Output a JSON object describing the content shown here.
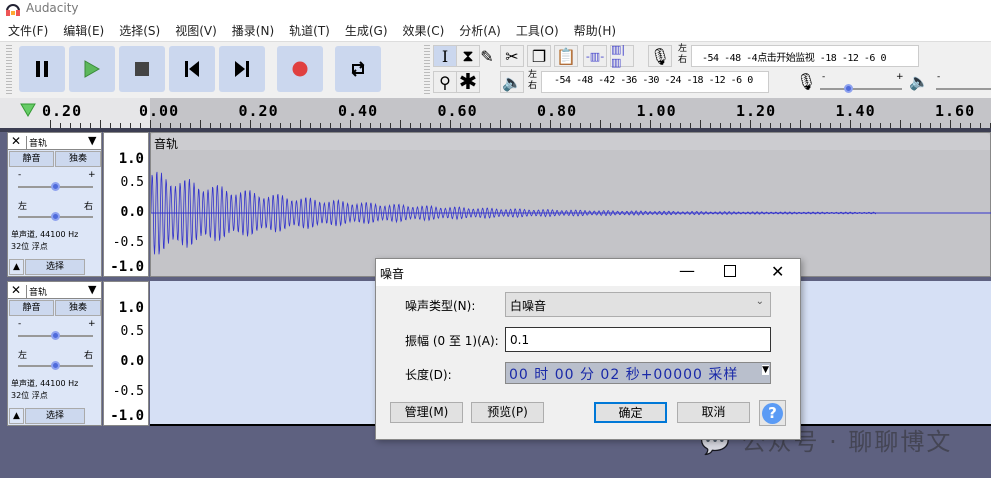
{
  "app": {
    "title": "Audacity"
  },
  "menu": [
    "文件(F)",
    "编辑(E)",
    "选择(S)",
    "视图(V)",
    "播录(N)",
    "轨道(T)",
    "生成(G)",
    "效果(C)",
    "分析(A)",
    "工具(O)",
    "帮助(H)"
  ],
  "meters": {
    "record_lr": [
      "左",
      "右"
    ],
    "record_scale": "-54 -48 -4",
    "record_hint": "点击开始监视",
    "record_scale2": "-18 -12  -6  0",
    "play_lr": [
      "左",
      "右"
    ],
    "play_scale": "-54 -48 -42 -36 -30 -24 -18 -12  -6  0",
    "mixer_minus": "-",
    "mixer_plus": "+"
  },
  "ruler": {
    "labels": [
      "0.20",
      "0.00",
      "0.20",
      "0.40",
      "0.60",
      "0.80",
      "1.00",
      "1.20",
      "1.40",
      "1.60"
    ]
  },
  "tracks": [
    {
      "name": "音轨",
      "clip_name": "音轨",
      "mute": "静音",
      "solo": "独奏",
      "gain_minus": "-",
      "gain_plus": "+",
      "pan_left": "左",
      "pan_right": "右",
      "info1": "单声道, 44100 Hz",
      "info2": "32位 浮点",
      "select": "选择",
      "scale": [
        "1.0",
        "0.5",
        "0.0",
        "-0.5",
        "-1.0"
      ]
    },
    {
      "name": "音轨",
      "mute": "静音",
      "solo": "独奏",
      "gain_minus": "-",
      "gain_plus": "+",
      "pan_left": "左",
      "pan_right": "右",
      "info1": "单声道, 44100 Hz",
      "info2": "32位 浮点",
      "select": "选择",
      "scale": [
        "1.0",
        "0.5",
        "0.0",
        "-0.5",
        "-1.0"
      ]
    }
  ],
  "dialog": {
    "title": "噪音",
    "noise_type_label": "噪声类型(N):",
    "noise_type_value": "白噪音",
    "amplitude_label": "振幅 (0 至 1)(A):",
    "amplitude_value": "0.1",
    "duration_label": "长度(D):",
    "duration_value": "00 时 00 分 02 秒+00000 采样",
    "manage": "管理(M)",
    "preview": "预览(P)",
    "ok": "确定",
    "cancel": "取消",
    "help": "?"
  },
  "watermark": "公众号 · 聊聊博文",
  "colors": {
    "accent": "#4f6bdb",
    "wave": "#3333cc",
    "selected_bg": "#c4c4c8",
    "track_bg": "#d6e0f5",
    "record": "#e04040",
    "play": "#4caf50"
  }
}
